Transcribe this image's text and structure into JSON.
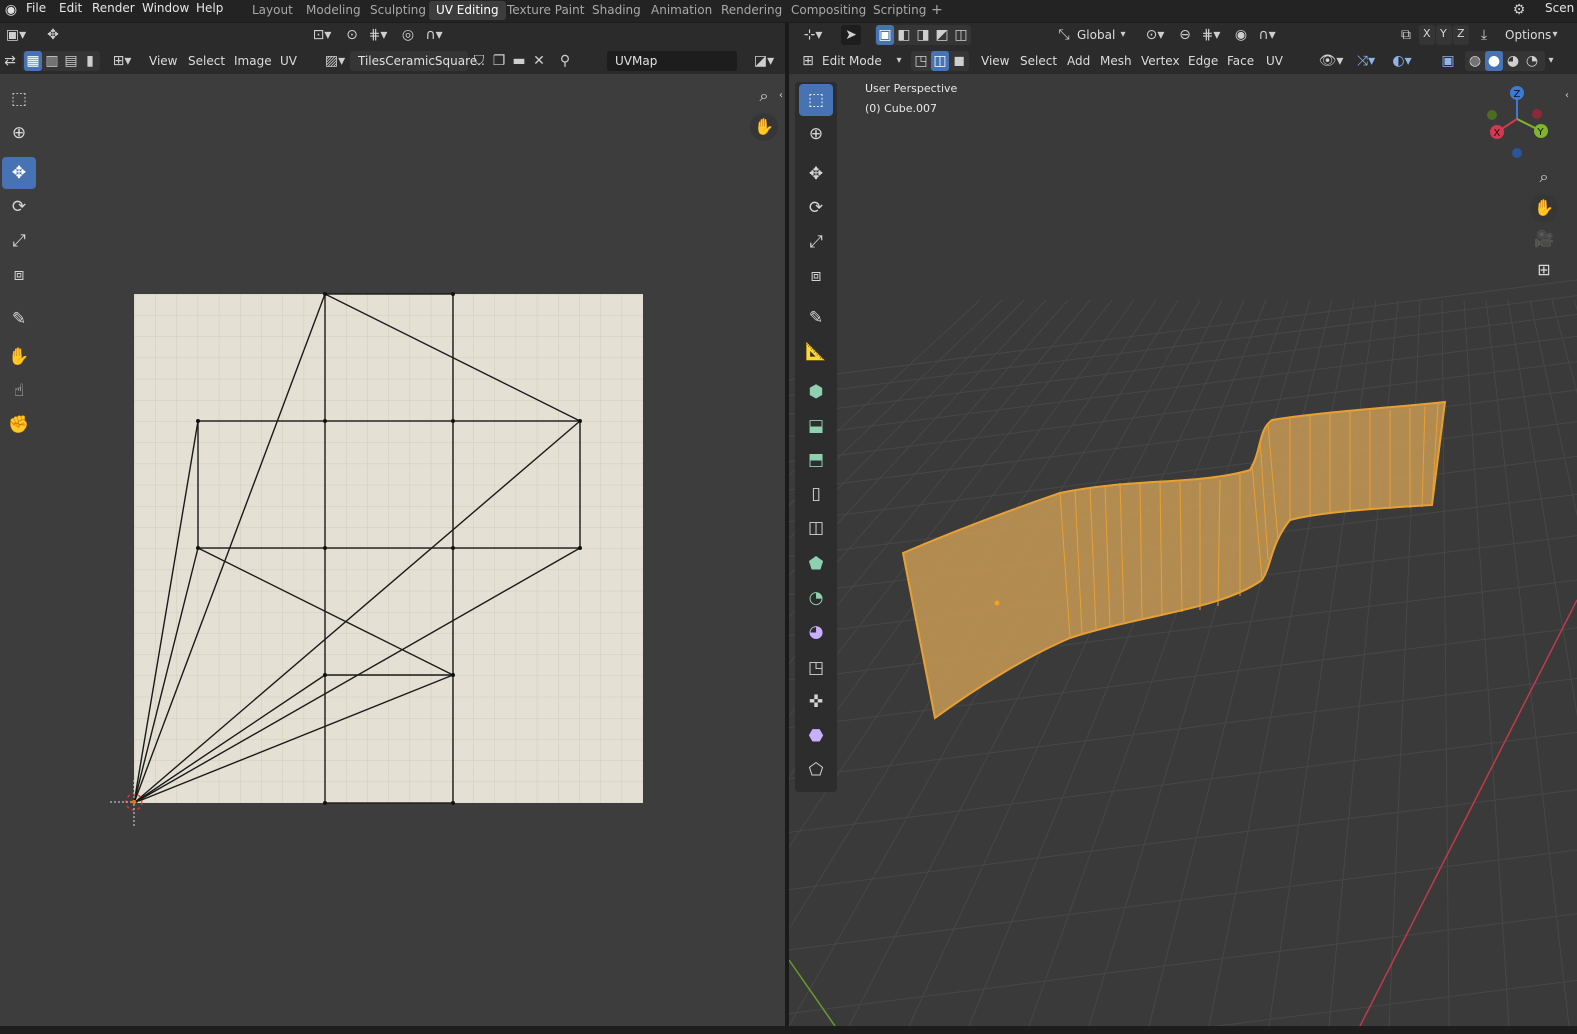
{
  "topbar": {
    "menus": [
      "File",
      "Edit",
      "Render",
      "Window",
      "Help"
    ],
    "workspaces": [
      "Layout",
      "Modeling",
      "Sculpting",
      "UV Editing",
      "Texture Paint",
      "Shading",
      "Animation",
      "Rendering",
      "Compositing",
      "Scripting"
    ],
    "active_workspace": "UV Editing",
    "add_workspace": "+",
    "scene_label": "Scen"
  },
  "uv_editor": {
    "menus": [
      "View",
      "Select",
      "Image",
      "UV"
    ],
    "image_name": "TilesCeramicSquare..",
    "uvmap_name": "UVMap"
  },
  "viewport": {
    "mode": "Edit Mode",
    "menus": [
      "View",
      "Select",
      "Add",
      "Mesh",
      "Vertex",
      "Edge",
      "Face",
      "UV"
    ],
    "orientation": "Global",
    "axes": [
      "X",
      "Y",
      "Z"
    ],
    "options_label": "Options",
    "overlay_title": "User Perspective",
    "overlay_object": "(0) Cube.007",
    "gizmo_labels": {
      "x": "X",
      "y": "Y",
      "z": "Z"
    }
  },
  "colors": {
    "accent": "#4772b3",
    "selection_orange": "#e8a033",
    "mesh_fill": "#c89a55",
    "grid_floor": "#3a3a3a",
    "axis_x": "#c03a4e",
    "axis_y": "#6a9a2b"
  },
  "icons": {
    "uv_tools": [
      "select-box-icon",
      "cursor-icon",
      "move-icon",
      "rotate-icon",
      "scale-icon",
      "transform-icon",
      "annotate-icon",
      "grab-icon",
      "relax-icon",
      "pinch-icon"
    ],
    "viewport_tools": [
      "select-box-icon",
      "cursor-icon",
      "move-icon",
      "rotate-icon",
      "scale-icon",
      "transform-icon",
      "annotate-icon",
      "measure-icon",
      "add-cube-icon",
      "extrude-icon",
      "inset-icon",
      "bevel-icon",
      "loop-cut-icon",
      "knife-icon",
      "poly-build-icon",
      "spin-icon",
      "smooth-icon",
      "edge-slide-icon",
      "shrink-fatten-icon",
      "shear-icon",
      "rip-icon"
    ]
  }
}
